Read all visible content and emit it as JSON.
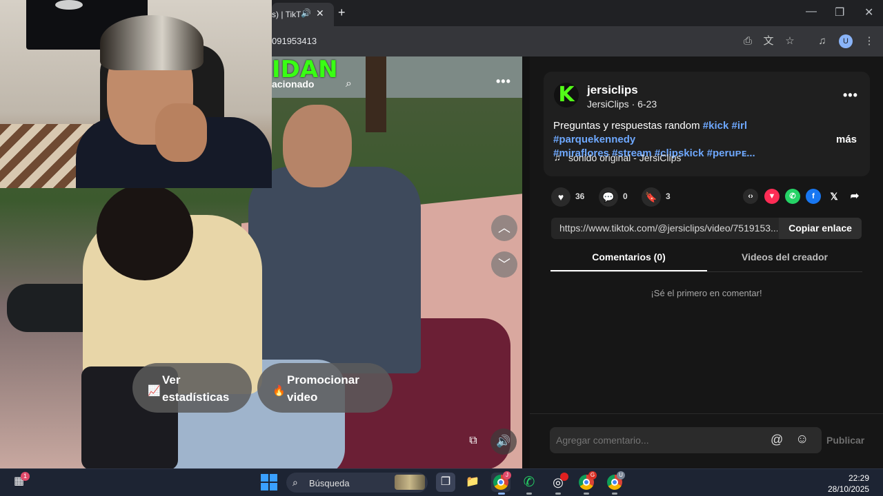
{
  "browser": {
    "tab_title": "s) | TikT",
    "url_text": "091953413"
  },
  "video": {
    "banner_text": "IDAN",
    "related_label": "acionado",
    "stats_button": "Ver\nestadísticas",
    "promo_button": "Promocionar\nvideo"
  },
  "post": {
    "author": "jersiclips",
    "author_sub": "JersiClips · 6-23",
    "desc_text": "Preguntas y respuestas random",
    "hashtags_line1": [
      "#kick",
      "#irl",
      "#parquekennedy"
    ],
    "hashtags_line2": [
      "#miraflores",
      "#stream",
      "#clipskick",
      "#peruᴘᴇ..."
    ],
    "more_label": "más",
    "sound": "sonido original - JersiClips",
    "likes": "36",
    "comments": "0",
    "saves": "3",
    "link_url": "https://www.tiktok.com/@jersiclips/video/7519153...",
    "copy_label": "Copiar enlace",
    "tab_comments": "Comentarios (0)",
    "tab_creator": "Videos del creador",
    "empty_message": "¡Sé el primero en comentar!",
    "comment_placeholder": "Agregar comentario...",
    "publish_label": "Publicar"
  },
  "taskbar": {
    "search_label": "Búsqueda",
    "widgets_badge": "1",
    "time": "22:29",
    "date": "28/10/2025"
  },
  "colors": {
    "hashtag": "#6ea8fe",
    "kick_green": "#53fc18",
    "panel_bg": "#161616"
  }
}
